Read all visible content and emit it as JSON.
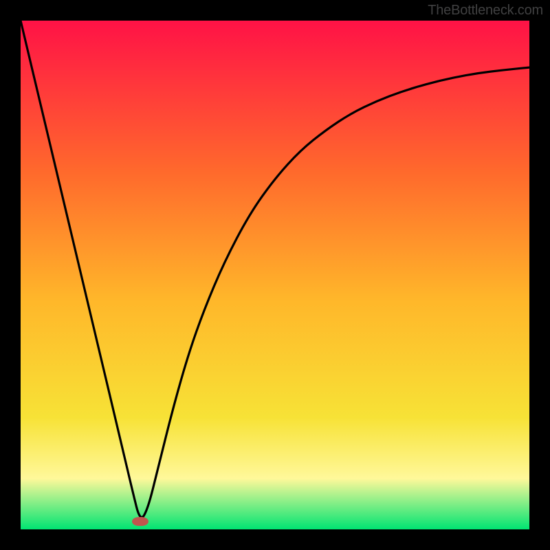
{
  "attribution": "TheBottleneck.com",
  "colors": {
    "frame": "#000000",
    "gradient_top": "#ff1246",
    "gradient_mid1": "#ff6a2c",
    "gradient_mid2": "#ffb72a",
    "gradient_mid3": "#f7e236",
    "gradient_mid4": "#fff89a",
    "gradient_bottom": "#00e472",
    "curve": "#000000",
    "marker": "#c1554e"
  },
  "chart_data": {
    "type": "line",
    "title": "",
    "xlabel": "",
    "ylabel": "",
    "xlim": [
      0,
      100
    ],
    "ylim": [
      0,
      100
    ],
    "series": [
      {
        "name": "bottleneck-curve",
        "x": [
          0,
          5,
          10,
          15,
          20,
          22,
          23.5,
          25,
          27,
          30,
          33,
          36,
          40,
          45,
          50,
          55,
          60,
          65,
          70,
          75,
          80,
          85,
          90,
          95,
          100
        ],
        "values": [
          100,
          79,
          58,
          37,
          16,
          7.5,
          1.5,
          4,
          12,
          24,
          34.5,
          43,
          52.5,
          62,
          69,
          74.5,
          78.5,
          81.8,
          84.2,
          86.1,
          87.6,
          88.8,
          89.7,
          90.3,
          90.8
        ]
      }
    ],
    "marker": {
      "x": 23.5,
      "y": 1.5,
      "shape": "pill",
      "color": "#c1554e"
    },
    "background_gradient": {
      "stops": [
        {
          "pos": 0.0,
          "color": "#ff1246"
        },
        {
          "pos": 0.3,
          "color": "#ff6a2c"
        },
        {
          "pos": 0.55,
          "color": "#ffb72a"
        },
        {
          "pos": 0.78,
          "color": "#f7e236"
        },
        {
          "pos": 0.9,
          "color": "#fff89a"
        },
        {
          "pos": 1.0,
          "color": "#00e472"
        }
      ]
    }
  }
}
